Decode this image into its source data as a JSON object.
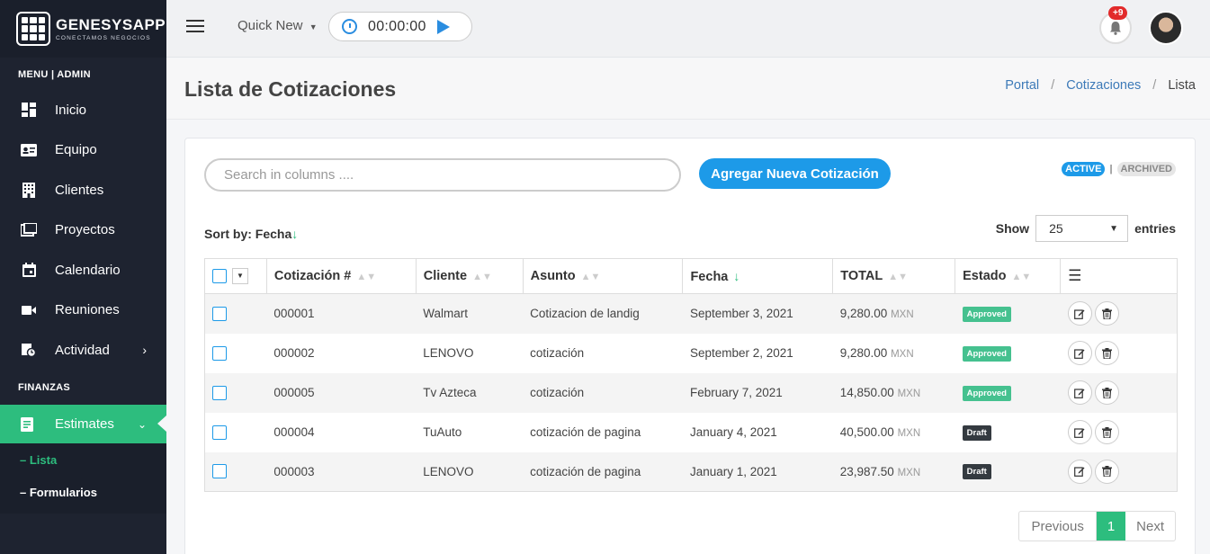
{
  "brand": {
    "title": "GENESYSAPP",
    "subtitle": "CONECTAMOS NEGOCIOS"
  },
  "sidebar": {
    "section_menu": "MENU | ADMIN",
    "items": [
      {
        "label": "Inicio",
        "icon": "dashboard-icon"
      },
      {
        "label": "Equipo",
        "icon": "id-card-icon"
      },
      {
        "label": "Clientes",
        "icon": "building-icon"
      },
      {
        "label": "Proyectos",
        "icon": "folders-icon"
      },
      {
        "label": "Calendario",
        "icon": "calendar-icon"
      },
      {
        "label": "Reuniones",
        "icon": "video-camera-icon"
      },
      {
        "label": "Actividad",
        "icon": "activity-icon"
      }
    ],
    "section_finanzas": "FINANZAS",
    "active_item": "Estimates",
    "sub_items": [
      "– Lista",
      "– Formularios"
    ]
  },
  "topbar": {
    "quick_new": "Quick New",
    "timer": "00:00:00",
    "notifications_badge": "+9"
  },
  "page": {
    "title": "Lista de Cotizaciones",
    "breadcrumb": [
      "Portal",
      "Cotizaciones",
      "Lista"
    ]
  },
  "toolbar": {
    "search_placeholder": "Search in columns ....",
    "add_button": "Agregar Nueva Cotización",
    "active_label": "ACTIVE",
    "archived_label": "ARCHIVED",
    "sort_by": "Sort by: Fecha",
    "sort_arrow": "↓",
    "show_label": "Show",
    "entries_value": "25",
    "entries_label": "entries"
  },
  "table": {
    "headers": [
      "Cotización #",
      "Cliente",
      "Asunto",
      "Fecha",
      "TOTAL",
      "Estado"
    ],
    "rows": [
      {
        "num": "000001",
        "cliente": "Walmart",
        "asunto": "Cotizacion de landig",
        "fecha": "September 3, 2021",
        "total": "9,280.00",
        "currency": "MXN",
        "estado": "Approved"
      },
      {
        "num": "000002",
        "cliente": "LENOVO",
        "asunto": "cotización",
        "fecha": "September 2, 2021",
        "total": "9,280.00",
        "currency": "MXN",
        "estado": "Approved"
      },
      {
        "num": "000005",
        "cliente": "Tv Azteca",
        "asunto": "cotización",
        "fecha": "February 7, 2021",
        "total": "14,850.00",
        "currency": "MXN",
        "estado": "Approved"
      },
      {
        "num": "000004",
        "cliente": "TuAuto",
        "asunto": "cotización de pagina",
        "fecha": "January 4, 2021",
        "total": "40,500.00",
        "currency": "MXN",
        "estado": "Draft"
      },
      {
        "num": "000003",
        "cliente": "LENOVO",
        "asunto": "cotización de pagina",
        "fecha": "January 1, 2021",
        "total": "23,987.50",
        "currency": "MXN",
        "estado": "Draft"
      }
    ]
  },
  "pagination": {
    "previous": "Previous",
    "current": "1",
    "next": "Next"
  },
  "colors": {
    "sidebar_bg": "#1e2330",
    "accent_green": "#2dbd7e",
    "accent_blue": "#1d9ae8",
    "draft": "#343a40"
  }
}
